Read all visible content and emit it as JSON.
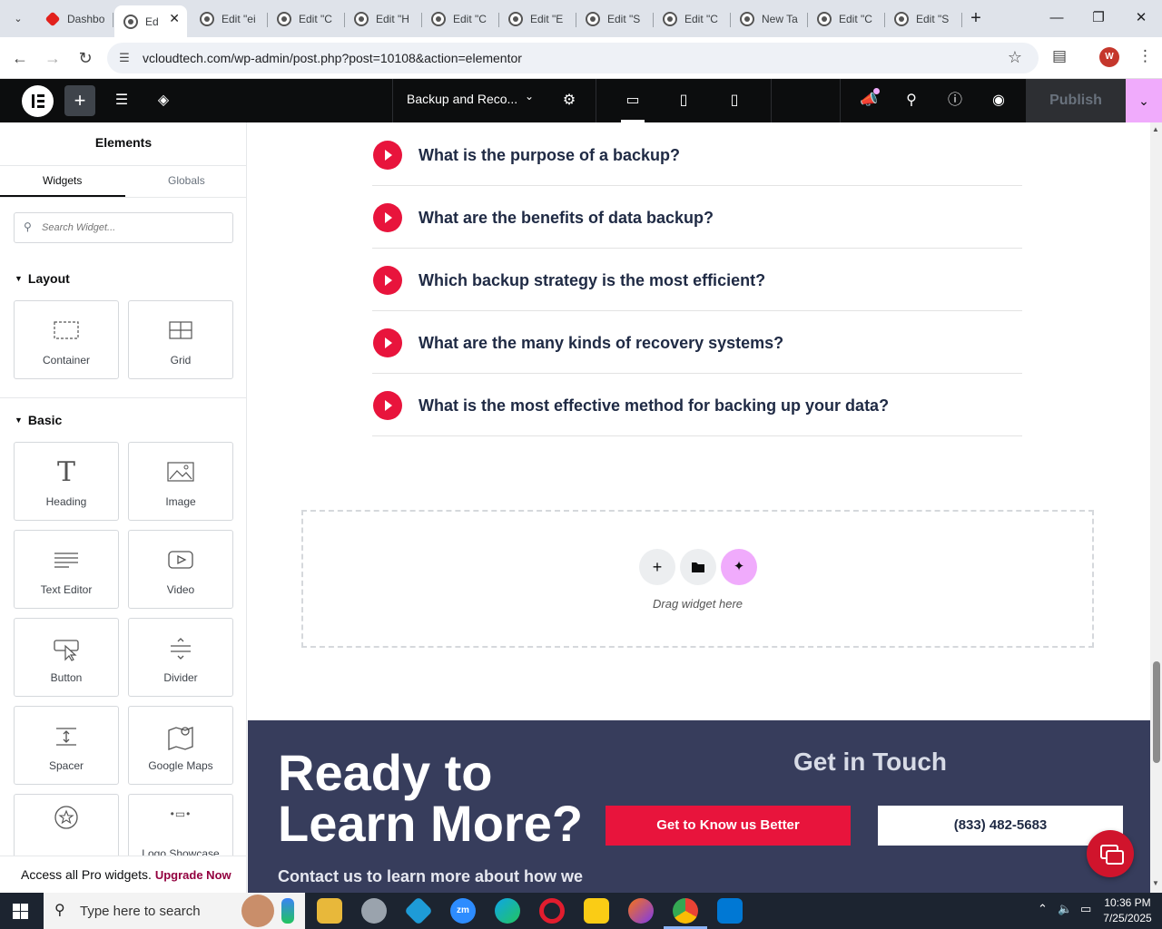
{
  "browser": {
    "tabs": [
      {
        "label": "Dashbo",
        "favicon": "red-diamond-icon",
        "active": false
      },
      {
        "label": "Ed",
        "favicon": "wordpress-icon",
        "active": true
      },
      {
        "label": "Edit \"ei",
        "favicon": "wordpress-icon",
        "active": false
      },
      {
        "label": "Edit \"C",
        "favicon": "wordpress-icon",
        "active": false
      },
      {
        "label": "Edit \"H",
        "favicon": "wordpress-icon",
        "active": false
      },
      {
        "label": "Edit \"C",
        "favicon": "wordpress-icon",
        "active": false
      },
      {
        "label": "Edit \"E",
        "favicon": "wordpress-icon",
        "active": false
      },
      {
        "label": "Edit \"S",
        "favicon": "wordpress-icon",
        "active": false
      },
      {
        "label": "Edit \"C",
        "favicon": "wordpress-icon",
        "active": false
      },
      {
        "label": "New Ta",
        "favicon": "wordpress-icon",
        "active": false
      },
      {
        "label": "Edit \"C",
        "favicon": "wordpress-icon",
        "active": false
      },
      {
        "label": "Edit \"S",
        "favicon": "wordpress-icon",
        "active": false
      }
    ],
    "url": "vcloudtech.com/wp-admin/post.php?post=10108&action=elementor",
    "profile_initial": "W"
  },
  "editor": {
    "doc_title": "Backup and Reco...",
    "publish_label": "Publish"
  },
  "panel": {
    "title": "Elements",
    "tabs": {
      "widgets": "Widgets",
      "globals": "Globals"
    },
    "search_placeholder": "Search Widget...",
    "layout_label": "Layout",
    "basic_label": "Basic",
    "layout_widgets": [
      "Container",
      "Grid"
    ],
    "basic_widgets": [
      "Heading",
      "Image",
      "Text Editor",
      "Video",
      "Button",
      "Divider",
      "Spacer",
      "Google Maps",
      "",
      "Logo Showcase"
    ],
    "promo_text": "Access all Pro widgets.",
    "promo_link": "Upgrade Now"
  },
  "canvas": {
    "faqs": [
      "What is the purpose of a backup?",
      "What are the benefits of data backup?",
      "Which backup strategy is the most efficient?",
      "What are the many kinds of recovery systems?",
      "What is the most effective method for backing up your data?"
    ],
    "drag_text": "Drag widget here",
    "cta_heading_1": "Ready to",
    "cta_heading_2": "Learn More?",
    "cta_sub": "Contact us to learn more about how we",
    "get_in_touch": "Get in Touch",
    "btn_know": "Get to Know us Better",
    "btn_phone": "(833) 482-5683"
  },
  "taskbar": {
    "search_placeholder": "Type here to search",
    "time": "10:36 PM",
    "date": "7/25/2025"
  },
  "colors": {
    "accent_red": "#e8143c",
    "footer_bg": "#373d5c",
    "ai_pink": "#f0abfc"
  }
}
